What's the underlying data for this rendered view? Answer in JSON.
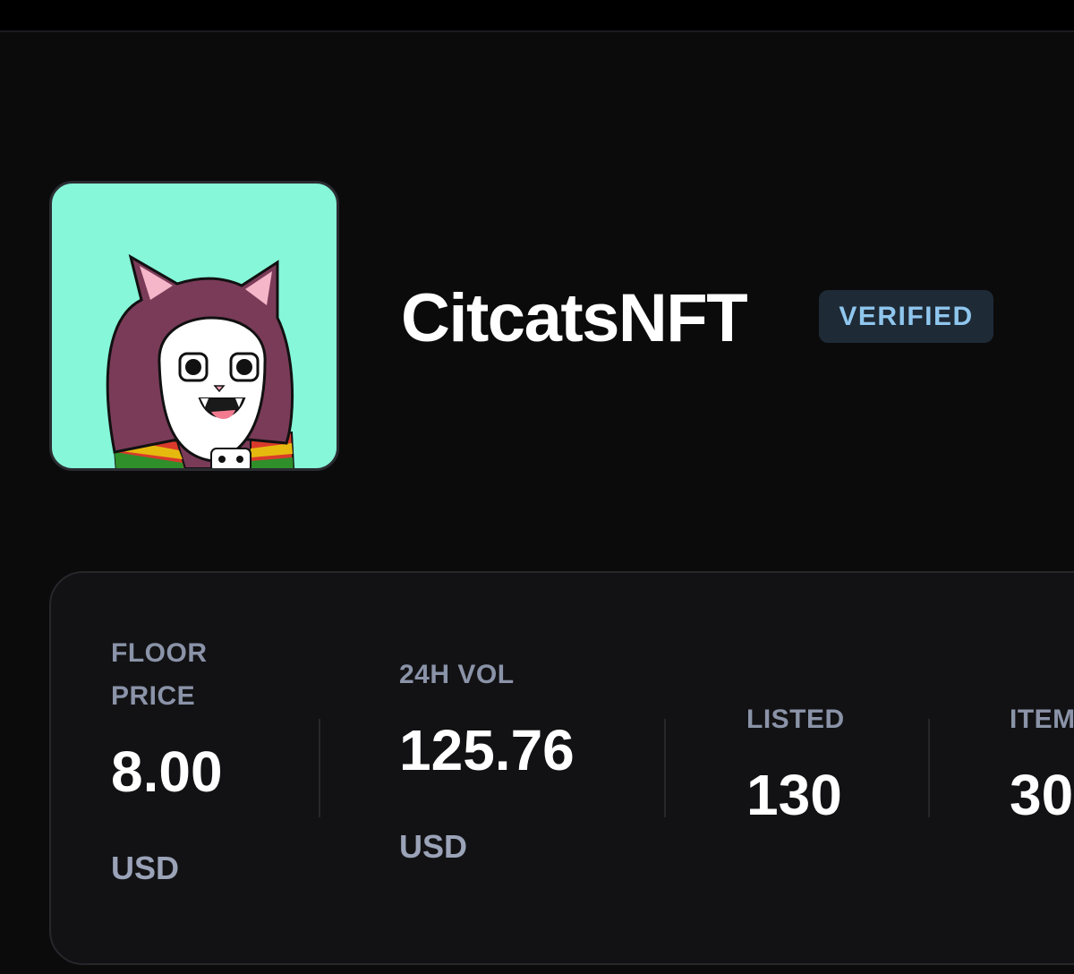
{
  "collection": {
    "name": "CitcatsNFT",
    "badge": "VERIFIED",
    "avatar_icon": "cat-nft-avatar",
    "avatar_background": "#86f7d9"
  },
  "stats": [
    {
      "label": "FLOOR\nPRICE",
      "value": "8.00",
      "unit": "USD"
    },
    {
      "label": "24H VOL",
      "value": "125.76",
      "unit": "USD"
    },
    {
      "label": "LISTED",
      "value": "130",
      "unit": ""
    },
    {
      "label": "ITEMS",
      "value": "30",
      "unit": ""
    }
  ],
  "colors": {
    "background": "#0b0b0c",
    "card": "#121214",
    "badge_bg": "#1e2a36",
    "badge_text": "#8fc6ee",
    "label": "#8a93a8"
  }
}
